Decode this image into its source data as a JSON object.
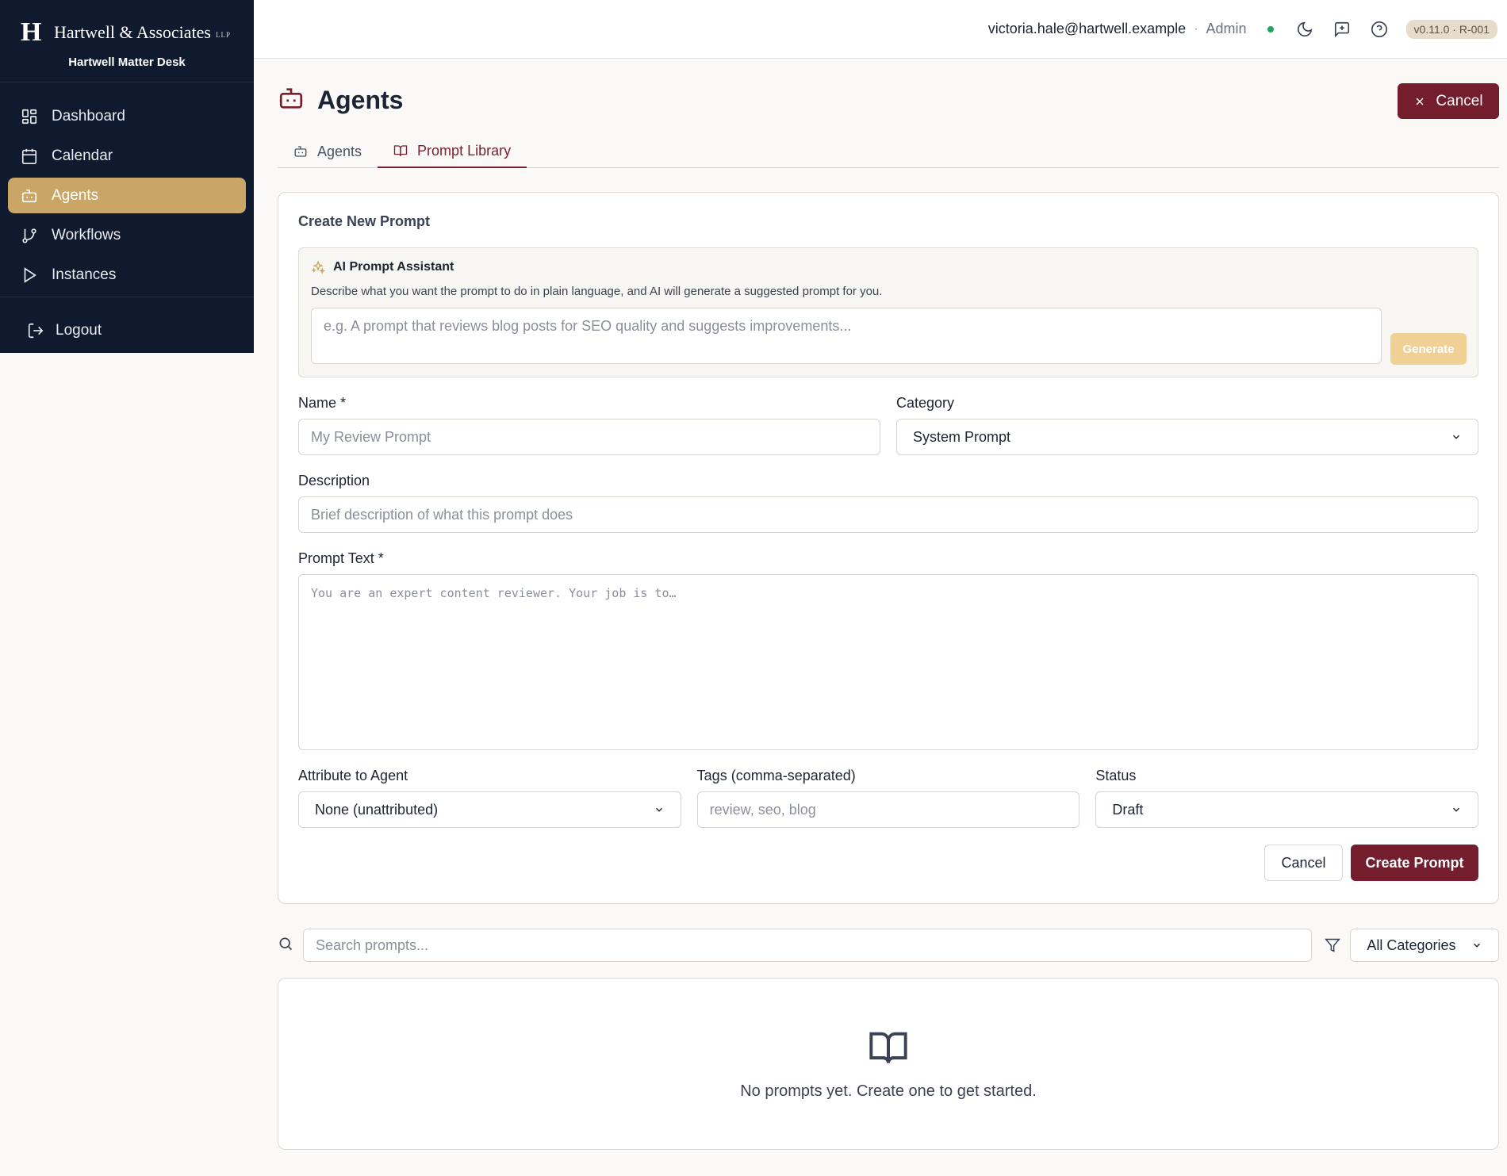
{
  "brand": {
    "mark": "H",
    "name": "Hartwell & Associates",
    "suffix": "LLP",
    "subtitle": "Hartwell Matter Desk"
  },
  "sidebar": {
    "items": [
      {
        "label": "Dashboard",
        "icon": "dashboard-icon",
        "active": false
      },
      {
        "label": "Calendar",
        "icon": "calendar-icon",
        "active": false
      },
      {
        "label": "Agents",
        "icon": "bot-icon",
        "active": true
      },
      {
        "label": "Workflows",
        "icon": "git-branch-icon",
        "active": false
      },
      {
        "label": "Instances",
        "icon": "play-icon",
        "active": false
      }
    ],
    "logout_label": "Logout"
  },
  "topbar": {
    "email": "victoria.hale@hartwell.example",
    "separator": "·",
    "role": "Admin",
    "version": "v0.11.0 · R-001",
    "status_color": "#22a55b"
  },
  "page": {
    "title": "Agents",
    "cancel_label": "Cancel",
    "tabs": [
      {
        "label": "Agents",
        "active": false
      },
      {
        "label": "Prompt Library",
        "active": true
      }
    ]
  },
  "form": {
    "title": "Create New Prompt",
    "ai": {
      "title": "AI Prompt Assistant",
      "description": "Describe what you want the prompt to do in plain language, and AI will generate a suggested prompt for you.",
      "placeholder": "e.g. A prompt that reviews blog posts for SEO quality and suggests improvements...",
      "generate_label": "Generate"
    },
    "name": {
      "label": "Name *",
      "placeholder": "My Review Prompt"
    },
    "category": {
      "label": "Category",
      "value": "System Prompt"
    },
    "description": {
      "label": "Description",
      "placeholder": "Brief description of what this prompt does"
    },
    "prompt_text": {
      "label": "Prompt Text *",
      "placeholder": "You are an expert content reviewer. Your job is to…"
    },
    "agent": {
      "label": "Attribute to Agent",
      "value": "None (unattributed)"
    },
    "tags": {
      "label": "Tags (comma-separated)",
      "placeholder": "review, seo, blog"
    },
    "status": {
      "label": "Status",
      "value": "Draft"
    },
    "cancel_label": "Cancel",
    "create_label": "Create Prompt"
  },
  "library": {
    "search_placeholder": "Search prompts...",
    "category_filter": "All Categories",
    "empty_text": "No prompts yet. Create one to get started."
  },
  "colors": {
    "brand": "#741d2c",
    "accent": "#c9a566",
    "sidebar_bg": "#0f1a2e"
  }
}
